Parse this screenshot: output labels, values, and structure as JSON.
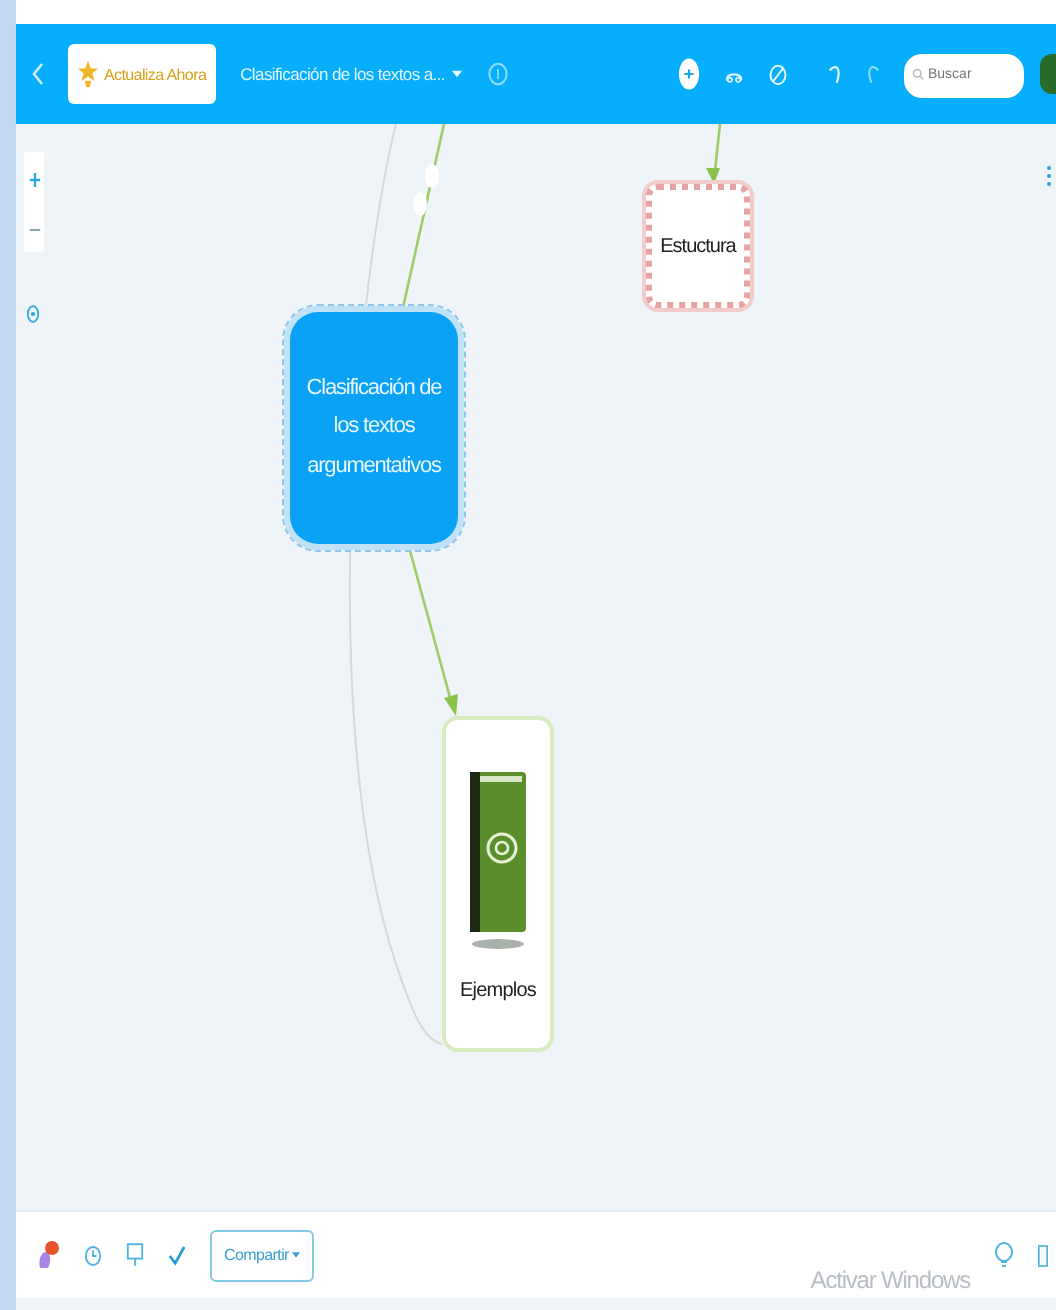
{
  "toolbar": {
    "upgrade_button": "Actualiza Ahora",
    "document_title": "Clasificación de los textos a...",
    "search": {
      "placeholder": "Buscar"
    }
  },
  "map": {
    "nodes": [
      {
        "kind": "central",
        "label": "Clasificación de los textos argumentativos",
        "selected": true
      },
      {
        "kind": "wavy",
        "label": "Estuctura",
        "selected": false
      },
      {
        "kind": "image",
        "label": "Ejemplos",
        "selected": false
      }
    ]
  },
  "bottom_bar": {
    "share_button": "Compartir",
    "os_notice": "Activar Windows"
  }
}
